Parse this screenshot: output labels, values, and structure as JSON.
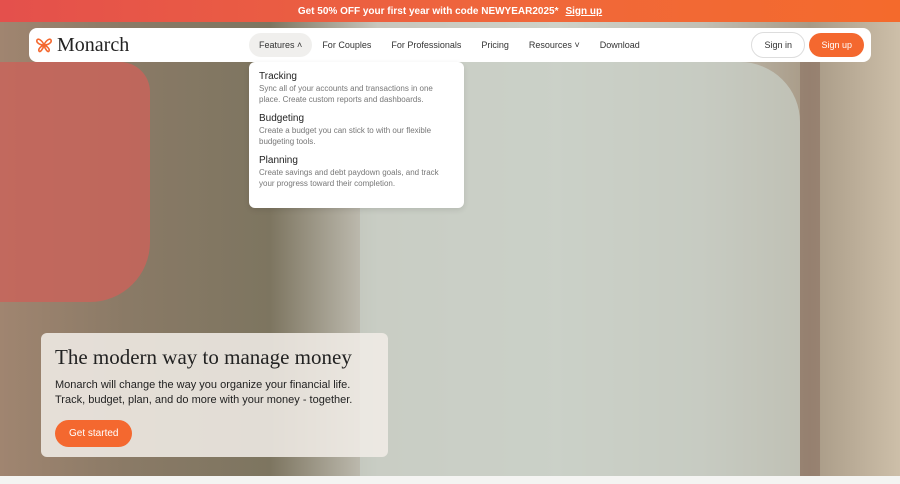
{
  "promo": {
    "text": "Get 50% OFF your first year with code NEWYEAR2025*",
    "link": "Sign up"
  },
  "nav": {
    "logo": "Monarch",
    "links": [
      "Features",
      "For Couples",
      "For Professionals",
      "Pricing",
      "Resources",
      "Download"
    ],
    "sign_in": "Sign in",
    "sign_up": "Sign up"
  },
  "features_menu": [
    {
      "title": "Tracking",
      "desc": "Sync all of your accounts and transactions in one place. Create custom reports and dashboards."
    },
    {
      "title": "Budgeting",
      "desc": "Create a budget you can stick to with our flexible budgeting tools."
    },
    {
      "title": "Planning",
      "desc": "Create savings and debt paydown goals, and track your progress toward their completion."
    }
  ],
  "hero": {
    "title": "The modern way to manage money",
    "line1": "Monarch will change the way you organize your financial life.",
    "line2": "Track, budget, plan, and do more with your money - together.",
    "cta": "Get started"
  },
  "colors": {
    "accent": "#f4682f"
  }
}
